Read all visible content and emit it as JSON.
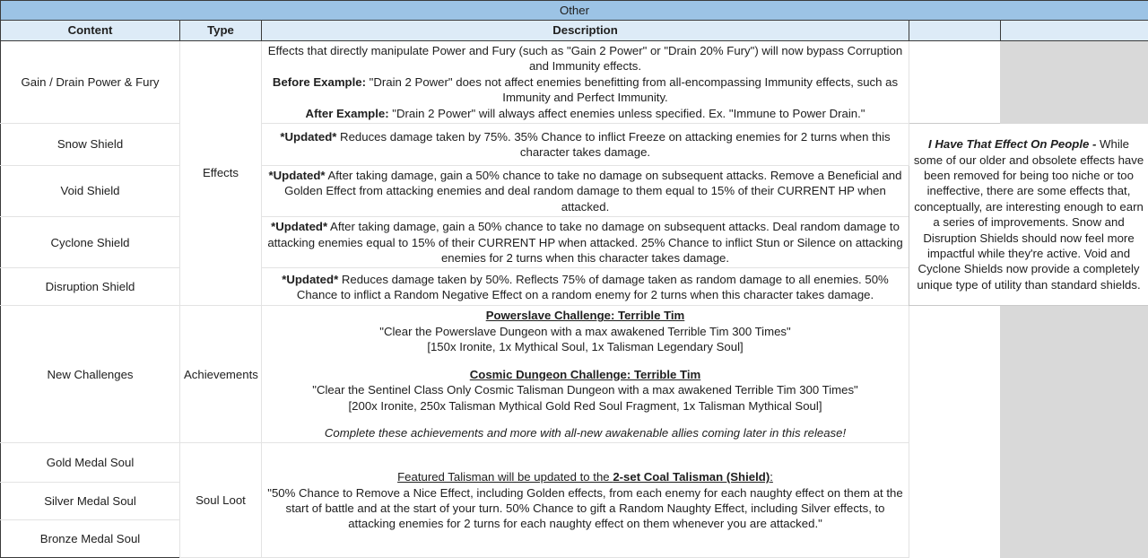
{
  "sheet": {
    "title": "Other",
    "columns": {
      "content": "Content",
      "type": "Type",
      "description": "Description",
      "blank_a": "",
      "blank_b": ""
    }
  },
  "rows": {
    "gain_drain": {
      "content": "Gain / Drain Power & Fury",
      "desc": {
        "line1": "Effects that directly manipulate Power and Fury (such as \"Gain 2 Power\" or \"Drain 20% Fury\") will now bypass Corruption and Immunity effects.",
        "before_label": "Before Example:",
        "before_text": " \"Drain 2 Power\" does not affect enemies benefitting from all-encompassing Immunity effects, such as Immunity and Perfect Immunity.",
        "after_label": "After Example:",
        "after_text": " \"Drain 2 Power\" will always affect enemies unless specified. Ex. \"Immune to Power Drain.\""
      }
    },
    "snow_shield": {
      "content": "Snow Shield",
      "updated_label": "*Updated*",
      "desc": " Reduces damage taken by 75%. 35% Chance to inflict Freeze on attacking enemies for 2 turns when this character takes damage."
    },
    "void_shield": {
      "content": "Void Shield",
      "updated_label": "*Updated*",
      "desc": " After taking damage, gain a 50% chance to take no damage on subsequent attacks. Remove a Beneficial and Golden Effect from attacking enemies and deal random damage to them equal to 15% of their CURRENT HP when attacked."
    },
    "cyclone_shield": {
      "content": "Cyclone Shield",
      "updated_label": "*Updated*",
      "desc": " After taking damage, gain a 50% chance to take no damage on subsequent attacks. Deal random damage to attacking enemies equal to 15% of their CURRENT HP when attacked. 25% Chance to inflict Stun or Silence on attacking enemies for 2 turns when this character takes damage."
    },
    "disruption_shield": {
      "content": "Disruption Shield",
      "updated_label": "*Updated*",
      "desc": " Reduces damage taken by 50%. Reflects 75% of damage taken as random damage to all enemies. 50% Chance to inflict a Random Negative Effect on a random enemy for 2 turns when this character takes damage."
    },
    "new_challenges": {
      "content": "New Challenges",
      "challenge1_title": "Powerslave Challenge: Terrible Tim",
      "challenge1_quote": "\"Clear the Powerslave Dungeon with a max awakened Terrible Tim 300 Times\"",
      "challenge1_reward": "[150x Ironite, 1x Mythical Soul, 1x Talisman Legendary Soul]",
      "challenge2_title": "Cosmic Dungeon Challenge: Terrible Tim",
      "challenge2_quote": "\"Clear the Sentinel Class Only Cosmic Talisman Dungeon with a max awakened Terrible Tim 300 Times\"",
      "challenge2_reward": "[200x Ironite, 250x Talisman Mythical Gold Red Soul Fragment, 1x Talisman Mythical Soul]",
      "footnote": "Complete these achievements and more with all-new awakenable allies coming later in this release!"
    },
    "gold_medal_soul": {
      "content": "Gold Medal Soul"
    },
    "silver_medal_soul": {
      "content": "Silver Medal Soul"
    },
    "bronze_medal_soul": {
      "content": "Bronze Medal Soul"
    },
    "soul_loot_desc": {
      "heading_plain": "Featured Talisman will be updated to the ",
      "heading_bold": "2-set Coal Talisman (Shield)",
      "heading_colon": ":",
      "body": "\"50% Chance to Remove a Nice Effect, including Golden effects, from each enemy for each naughty effect on them at the start of battle and at the start of your turn. 50% Chance to gift a Random Naughty Effect, including Silver effects, to attacking enemies for 2 turns for each naughty effect on them whenever you are attacked.\""
    }
  },
  "type_groups": {
    "effects": "Effects",
    "achievements": "Achievements",
    "soul_loot": "Soul Loot"
  },
  "notes": {
    "title": "I Have That Effect On People -",
    "body": " While some of our older and obsolete effects have been removed for being too niche or too ineffective, there are some effects that, conceptually, are interesting enough to earn a series of improvements. Snow and Disruption Shields should now feel more impactful while they're active. Void and Cyclone Shields now provide a completely unique type of utility than standard shields."
  },
  "colors": {
    "title_band": "#9cc3e5",
    "header_band": "#ddebf7",
    "grey_fill": "#d9d9d9",
    "grid_line": "#e3e3e3",
    "frame_line": "#3b3b3b"
  }
}
